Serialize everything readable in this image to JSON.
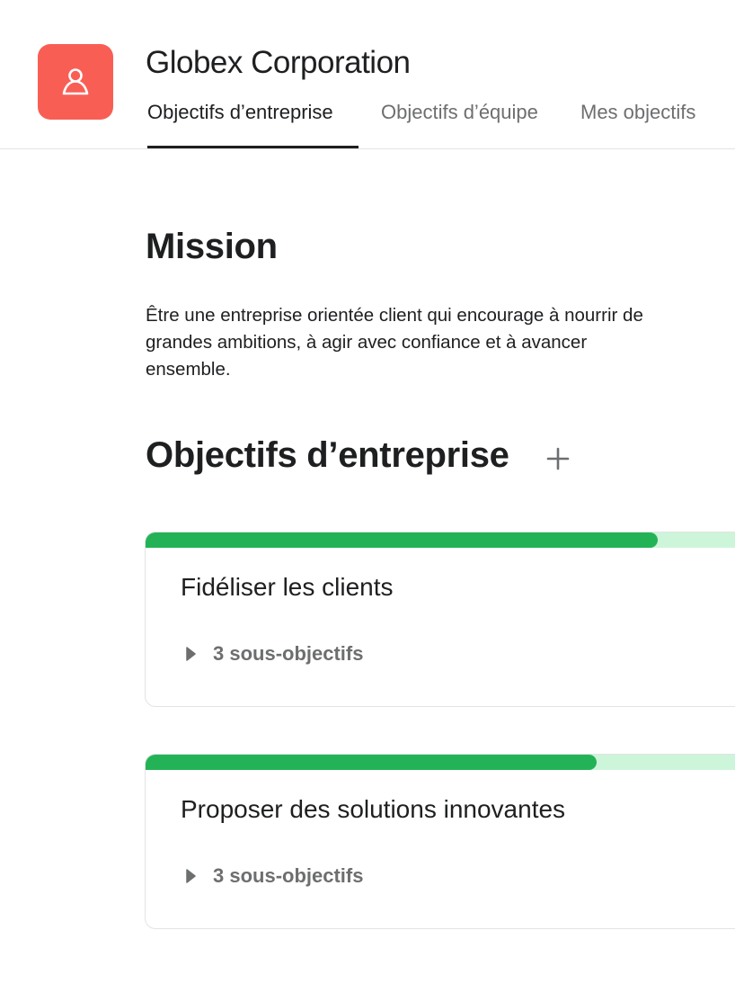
{
  "organization": {
    "name": "Globex Corporation",
    "logo_icon": "people-icon"
  },
  "tabs": [
    {
      "label": "Objectifs d’entreprise",
      "active": true
    },
    {
      "label": "Objectifs d’équipe",
      "active": false
    },
    {
      "label": "Mes objectifs",
      "active": false
    }
  ],
  "mission": {
    "title": "Mission",
    "text": "Être une entreprise orientée client qui encourage à nourrir de grandes ambitions, à agir avec confiance et à avancer ensemble."
  },
  "goals_section": {
    "title": "Objectifs d’entreprise",
    "add_icon": "plus-icon"
  },
  "goals": [
    {
      "title": "Fidéliser les clients",
      "subgoals_label": "3 sous-objectifs",
      "progress": 0.84
    },
    {
      "title": "Proposer des solutions innovantes",
      "subgoals_label": "3 sous-objectifs",
      "progress": 0.74
    }
  ],
  "colors": {
    "brand": "#f95e55",
    "progress_fill": "#23b356",
    "progress_track": "#cdf5da",
    "icon_gray": "#6d6e6f"
  }
}
